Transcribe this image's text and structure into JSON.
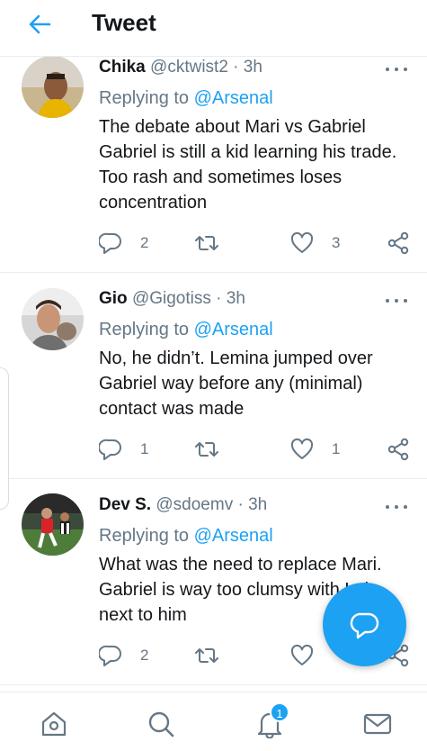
{
  "header": {
    "title": "Tweet"
  },
  "tweets": [
    {
      "name": "Chika",
      "handle": "@cktwist2",
      "time": "· 3h",
      "replying_prefix": "Replying to ",
      "replying_to": "@Arsenal",
      "body": "The debate about Mari vs Gabriel Gabriel is still a kid learning his trade. Too rash and sometimes loses concentration",
      "reply_count": "2",
      "retweet_count": "",
      "like_count": "3"
    },
    {
      "name": "Gio",
      "handle": "@Gigotiss",
      "time": "· 3h",
      "replying_prefix": "Replying to ",
      "replying_to": "@Arsenal",
      "body": "No, he didn’t. Lemina jumped over Gabriel way before any (minimal) contact was made",
      "reply_count": "1",
      "retweet_count": "",
      "like_count": "1"
    },
    {
      "name": "Dev S.",
      "handle": "@sdoemv",
      "time": "· 3h",
      "replying_prefix": "Replying to ",
      "replying_to": "@Arsenal",
      "body": "What was the need to replace Mari. Gabriel is way too clumsy with Luiz next to him",
      "reply_count": "2",
      "retweet_count": "",
      "like_count": ""
    }
  ],
  "bottom_nav": {
    "notification_badge": "1"
  },
  "icons": {
    "back": "arrow-left-icon",
    "more": "more-horizontal-icon",
    "reply": "comment-bubble-icon",
    "retweet": "retweet-icon",
    "like": "heart-icon",
    "share": "share-icon",
    "home": "home-icon",
    "search": "search-icon",
    "notifications": "bell-icon",
    "messages": "envelope-icon",
    "compose": "compose-reply-icon"
  },
  "colors": {
    "accent": "#1da1f2",
    "text": "#14171a",
    "muted": "#657786",
    "divider": "#e6ecf0"
  }
}
